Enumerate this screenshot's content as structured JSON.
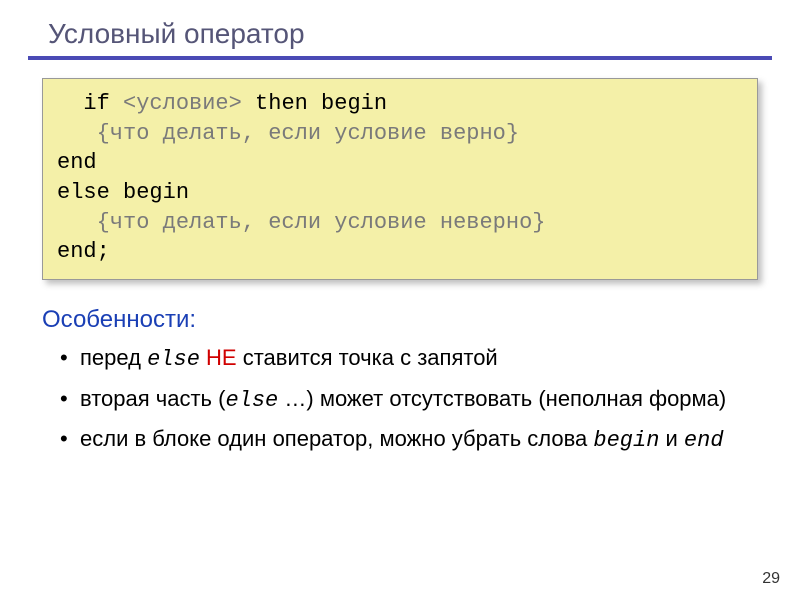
{
  "title": "Условный оператор",
  "code": {
    "l1a": "  if ",
    "l1b": "<условие>",
    "l1c": " then begin",
    "l2": "   {что делать, если условие верно}",
    "l3": "end",
    "l4": "else begin",
    "l5": "   {что делать, если условие неверно}",
    "l6": "end;"
  },
  "features": {
    "heading": "Особенности:",
    "b1_pre": "перед ",
    "b1_code": "else",
    "b1_mid": " ",
    "b1_red": "НЕ",
    "b1_post": " ставится точка с запятой",
    "b2_pre": "вторая часть (",
    "b2_code": "else",
    "b2_post": " …) может отсутствовать (неполная форма)",
    "b3_pre": "если в блоке один оператор, можно убрать слова ",
    "b3_code1": "begin",
    "b3_mid": " и ",
    "b3_code2": "end"
  },
  "page": "29"
}
